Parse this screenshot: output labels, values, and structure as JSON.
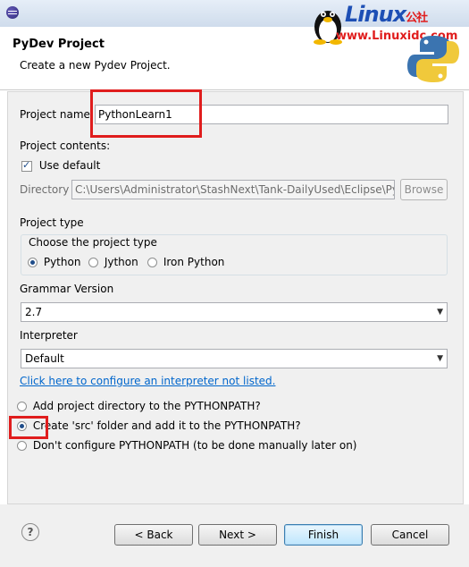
{
  "header": {
    "title": "PyDev Project",
    "subtitle": "Create a new Pydev Project."
  },
  "watermark": {
    "brand": "Linux",
    "brand_cn": "公社",
    "url": "www.Linuxidc.com"
  },
  "project_name": {
    "label": "Project name:",
    "value": "PythonLearn1"
  },
  "project_contents": {
    "label": "Project contents:",
    "use_default_label": "Use default",
    "use_default_checked": true,
    "directory_label": "Directory",
    "directory_value": "C:\\Users\\Administrator\\StashNext\\Tank-DailyUsed\\Eclipse\\Py",
    "browse_label": "Browse"
  },
  "project_type": {
    "label": "Project type",
    "group_title": "Choose the project type",
    "options": [
      "Python",
      "Jython",
      "Iron Python"
    ],
    "selected": "Python"
  },
  "grammar": {
    "label": "Grammar Version",
    "value": "2.7"
  },
  "interpreter": {
    "label": "Interpreter",
    "value": "Default",
    "configure_link": "Click here to configure an interpreter not listed."
  },
  "pythonpath": {
    "options": [
      "Add project directory to the PYTHONPATH?",
      "Create 'src' folder and add it to the PYTHONPATH?",
      "Don't configure PYTHONPATH (to be done manually later on)"
    ],
    "selected": 1
  },
  "buttons": {
    "back": "< Back",
    "next": "Next >",
    "finish": "Finish",
    "cancel": "Cancel"
  },
  "colors": {
    "highlight": "#e01d1d",
    "link": "#0066cc",
    "default_button": "#3c7fb1"
  }
}
